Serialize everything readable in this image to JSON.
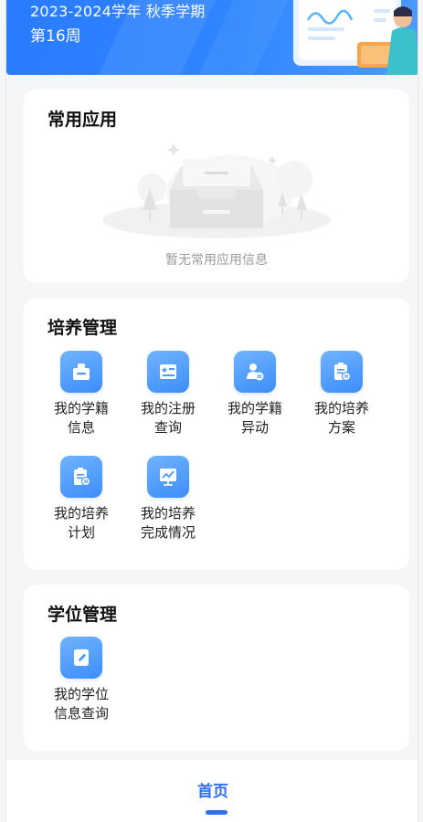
{
  "header": {
    "term": "2023-2024学年 秋季学期",
    "week": "第16周"
  },
  "common_apps": {
    "title": "常用应用",
    "empty_text": "暂无常用应用信息"
  },
  "training": {
    "title": "培养管理",
    "items": [
      {
        "line1": "我的学籍",
        "line2": "信息",
        "icon": "id-card-icon"
      },
      {
        "line1": "我的注册",
        "line2": "查询",
        "icon": "register-certificate-icon"
      },
      {
        "line1": "我的学籍",
        "line2": "异动",
        "icon": "user-change-icon"
      },
      {
        "line1": "我的培养",
        "line2": "方案",
        "icon": "plan-document-icon"
      },
      {
        "line1": "我的培养",
        "line2": "计划",
        "icon": "schedule-document-icon"
      },
      {
        "line1": "我的培养",
        "line2": "完成情况",
        "icon": "chart-board-icon"
      }
    ]
  },
  "degree": {
    "title": "学位管理",
    "items": [
      {
        "line1": "我的学位",
        "line2": "信息查询",
        "icon": "edit-document-icon"
      }
    ]
  },
  "tabbar": {
    "home_label": "首页"
  },
  "colors": {
    "primary": "#2f6ff0",
    "banner": "#2f86ff",
    "icon_gradient_start": "#6fb4ff",
    "icon_gradient_end": "#3d8dfa"
  }
}
